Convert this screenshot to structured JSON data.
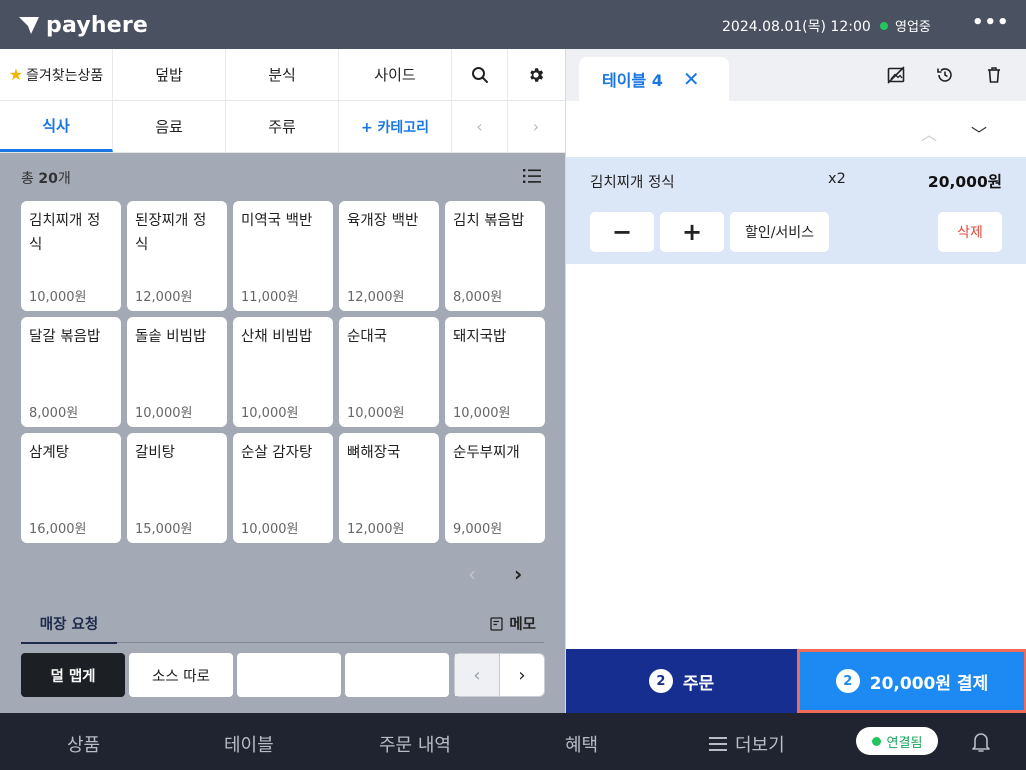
{
  "topbar": {
    "logo": "payhere",
    "datetime": "2024.08.01(목) 12:00",
    "status": "영업중",
    "more": "•••"
  },
  "categories": {
    "row1": [
      "즐겨찾는상품",
      "덮밥",
      "분식",
      "사이드"
    ],
    "row2": [
      "식사",
      "음료",
      "주류",
      "+ 카테고리"
    ],
    "active": "식사"
  },
  "products": {
    "count_prefix": "총",
    "count_value": "20",
    "count_suffix": "개",
    "items": [
      {
        "name": "김치찌개 정식",
        "price": "10,000원"
      },
      {
        "name": "된장찌개 정식",
        "price": "12,000원"
      },
      {
        "name": "미역국 백반",
        "price": "11,000원"
      },
      {
        "name": "육개장 백반",
        "price": "12,000원"
      },
      {
        "name": "김치 볶음밥",
        "price": "8,000원"
      },
      {
        "name": "달갈 볶음밥",
        "price": "8,000원"
      },
      {
        "name": "돌솥 비빔밥",
        "price": "10,000원"
      },
      {
        "name": "산채 비빔밥",
        "price": "10,000원"
      },
      {
        "name": "순대국",
        "price": "10,000원"
      },
      {
        "name": "돼지국밥",
        "price": "10,000원"
      },
      {
        "name": "삼계탕",
        "price": "16,000원"
      },
      {
        "name": "갈비탕",
        "price": "15,000원"
      },
      {
        "name": "순살 감자탕",
        "price": "10,000원"
      },
      {
        "name": "뼈해장국",
        "price": "12,000원"
      },
      {
        "name": "순두부찌개",
        "price": "9,000원"
      }
    ]
  },
  "store_request": {
    "tab": "매장 요청",
    "memo": "메모",
    "options": [
      "덜 맵게",
      "소스 따로",
      "",
      ""
    ]
  },
  "order": {
    "table_tab": "테이블 4",
    "item": {
      "name": "김치찌개 정식",
      "qty": "x2",
      "price": "20,000원"
    },
    "minus": "−",
    "plus": "+",
    "discount": "할인/서비스",
    "delete": "삭제",
    "order_count": "2",
    "order_label": "주문",
    "pay_count": "2",
    "pay_label": "20,000원 결제"
  },
  "bottom_nav": {
    "products": "상품",
    "tables": "테이블",
    "order_history": "주문 내역",
    "benefits": "혜택",
    "more": "더보기",
    "connection": "연결됨"
  },
  "colors": {
    "accent": "#1877e5",
    "order_button": "#162e8f",
    "pay_button": "#1c8af2",
    "pay_border": "#f06b5a",
    "online": "#22c55e"
  }
}
